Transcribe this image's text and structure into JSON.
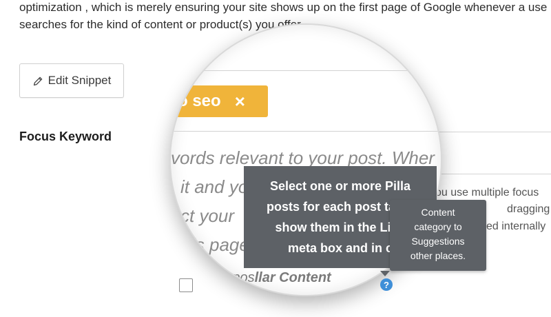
{
  "intro": {
    "line1": "optimization , which is merely ensuring your site shows up on the first page of Google whenever a use",
    "line2": "searches for the kind of content or product(s) you offer."
  },
  "edit_snippet": {
    "label": "Edit Snippet",
    "icon": "pencil-icon"
  },
  "focus_keyword": {
    "label": "Focus Keyword",
    "tag": "o seo",
    "tag_remove": "×",
    "tag_color": "#f0b43a"
  },
  "background_help": {
    "line1": "ou use multiple focus",
    "line2": "dragging it",
    "line3": "ed internally"
  },
  "magnified_helper": {
    "line1": "vords relevant to your post. Wher",
    "line2": "it and yo",
    "line3": "ct your",
    "line4": "is page",
    "line5": "opti",
    "small": "w"
  },
  "pillar": {
    "label_start": "This pos",
    "label_end": "llar Content",
    "help_icon": "question-icon",
    "help_color": "#3f8fd8"
  },
  "tooltip_big": {
    "line1": "Select one or more Pilla",
    "line2": "posts for each post tag o",
    "line3": "show them in the Link",
    "line4": "meta box and in c"
  },
  "tooltip_small": {
    "line1": "Content",
    "line2": "category to",
    "line3": "Suggestions",
    "line4": "other places.",
    "bg_color": "#5d6166"
  }
}
